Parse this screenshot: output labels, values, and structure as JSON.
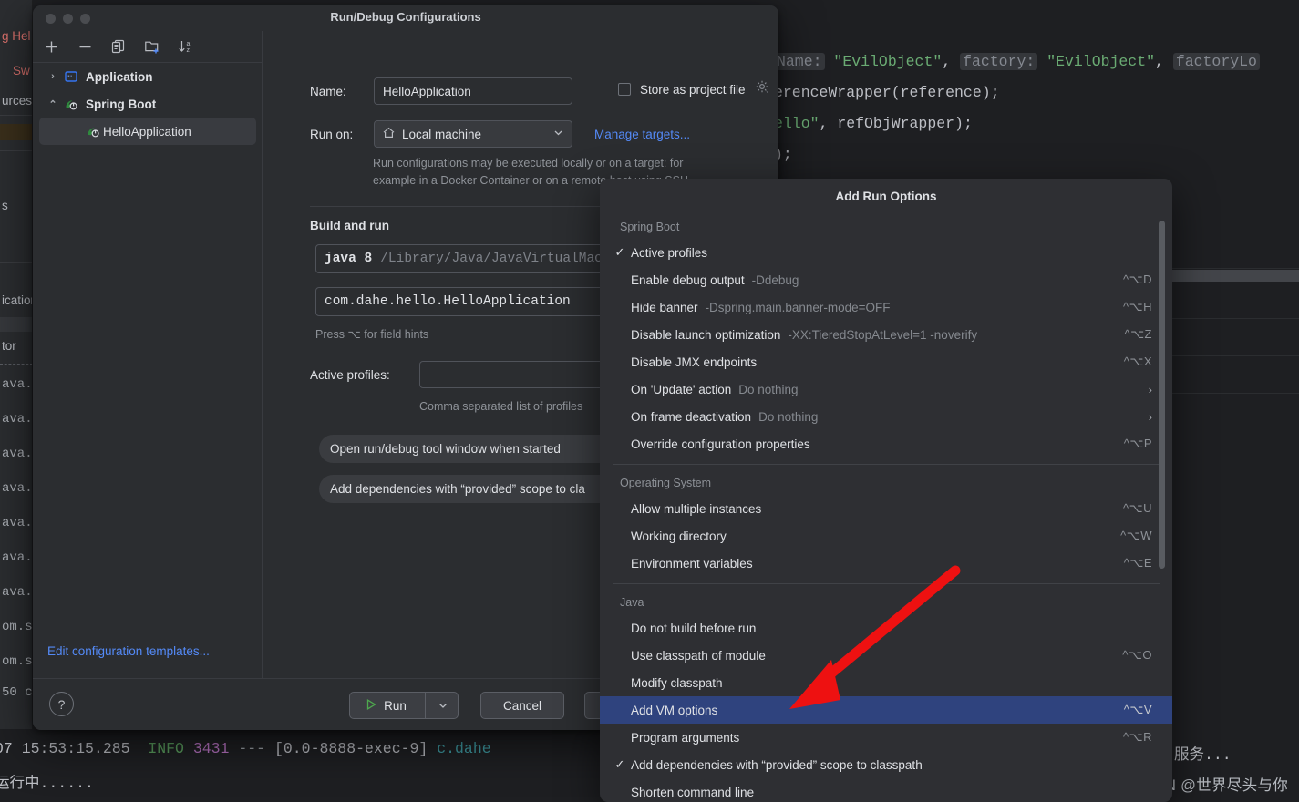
{
  "background": {
    "left_strip_lines": [
      "g Hel",
      "Sw",
      "urces",
      "s",
      "ication",
      "tor",
      "ava.",
      "ava.",
      "ava.",
      "ava.",
      "ava.",
      "ava.",
      "ava.",
      "om.s",
      "om.s",
      "50  c"
    ],
    "editor_code_lines": [
      "Name: \"EvilObject\",  factory: \"EvilObject\",  factoryLo",
      "erenceWrapper(reference);",
      "ello\", refObjWrapper);",
      ");"
    ],
    "console_left": "07 15:53:15.285  INFO 3431 --- [0.0-8888-exec-9] c.dahe",
    "console_left_2": "运行中......",
    "console_right": "服务...",
    "watermark": "CSDN @世界尽头与你"
  },
  "dialog": {
    "title": "Run/Debug Configurations",
    "toolbar_icons": [
      "add-icon",
      "remove-icon",
      "copy-icon",
      "new-folder-icon",
      "sort-alphabetically-icon"
    ],
    "tree": [
      {
        "label": "Application",
        "icon": "application-icon",
        "chevron": "›",
        "level": 0,
        "selected": false,
        "bold": true
      },
      {
        "label": "Spring Boot",
        "icon": "spring-boot-icon",
        "chevron": "⌄",
        "level": 0,
        "selected": false,
        "bold": true
      },
      {
        "label": "HelloApplication",
        "icon": "spring-boot-icon",
        "chevron": "",
        "level": 1,
        "selected": true,
        "bold": false
      }
    ],
    "edit_templates_link": "Edit configuration templates...",
    "form": {
      "name_label": "Name:",
      "name_value": "HelloApplication",
      "store_as_project_file_label": "Store as project file",
      "store_as_project_file_checked": false,
      "run_on_label": "Run on:",
      "run_on_value": "Local machine",
      "manage_targets_link": "Manage targets...",
      "run_on_hint_line1": "Run configurations may be executed locally or on a target: for",
      "run_on_hint_line2": "example in a Docker Container or on a remote host using SSH.",
      "build_and_run_title": "Build and run",
      "jdk_strong": "java 8",
      "jdk_path": "/Library/Java/JavaVirtualMachin",
      "main_class": "com.dahe.hello.HelloApplication",
      "field_hints": "Press ⌥ for field hints",
      "active_profiles_label": "Active profiles:",
      "active_profiles_value": "",
      "active_profiles_hint": "Comma separated list of profiles",
      "chip1": "Open run/debug tool window when started",
      "chip1_close": "×",
      "chip2": "Add dependencies with “provided” scope to cla"
    },
    "footer": {
      "help_label": "?",
      "run_label": "Run",
      "run_dropdown": "⌄",
      "cancel_label": "Cancel"
    }
  },
  "popup": {
    "title": "Add Run Options",
    "groups": [
      {
        "label": "Spring Boot",
        "items": [
          {
            "label": "Active profiles",
            "sub": "",
            "accel": "",
            "checked": true,
            "submenu": false,
            "selected": false
          },
          {
            "label": "Enable debug output",
            "sub": "-Ddebug",
            "accel": "^⌥D",
            "checked": false,
            "submenu": false,
            "selected": false
          },
          {
            "label": "Hide banner",
            "sub": "-Dspring.main.banner-mode=OFF",
            "accel": "^⌥H",
            "checked": false,
            "submenu": false,
            "selected": false
          },
          {
            "label": "Disable launch optimization",
            "sub": "-XX:TieredStopAtLevel=1 -noverify",
            "accel": "^⌥Z",
            "checked": false,
            "submenu": false,
            "selected": false
          },
          {
            "label": "Disable JMX endpoints",
            "sub": "",
            "accel": "^⌥X",
            "checked": false,
            "submenu": false,
            "selected": false
          },
          {
            "label": "On 'Update' action",
            "sub": "Do nothing",
            "accel": "",
            "checked": false,
            "submenu": true,
            "selected": false
          },
          {
            "label": "On frame deactivation",
            "sub": "Do nothing",
            "accel": "",
            "checked": false,
            "submenu": true,
            "selected": false
          },
          {
            "label": "Override configuration properties",
            "sub": "",
            "accel": "^⌥P",
            "checked": false,
            "submenu": false,
            "selected": false
          }
        ]
      },
      {
        "label": "Operating System",
        "items": [
          {
            "label": "Allow multiple instances",
            "sub": "",
            "accel": "^⌥U",
            "checked": false,
            "submenu": false,
            "selected": false
          },
          {
            "label": "Working directory",
            "sub": "",
            "accel": "^⌥W",
            "checked": false,
            "submenu": false,
            "selected": false
          },
          {
            "label": "Environment variables",
            "sub": "",
            "accel": "^⌥E",
            "checked": false,
            "submenu": false,
            "selected": false
          }
        ]
      },
      {
        "label": "Java",
        "items": [
          {
            "label": "Do not build before run",
            "sub": "",
            "accel": "",
            "checked": false,
            "submenu": false,
            "selected": false
          },
          {
            "label": "Use classpath of module",
            "sub": "",
            "accel": "^⌥O",
            "checked": false,
            "submenu": false,
            "selected": false
          },
          {
            "label": "Modify classpath",
            "sub": "",
            "accel": "",
            "checked": false,
            "submenu": false,
            "selected": false
          },
          {
            "label": "Add VM options",
            "sub": "",
            "accel": "^⌥V",
            "checked": false,
            "submenu": false,
            "selected": true
          },
          {
            "label": "Program arguments",
            "sub": "",
            "accel": "^⌥R",
            "checked": false,
            "submenu": false,
            "selected": false
          },
          {
            "label": "Add dependencies with “provided” scope to classpath",
            "sub": "",
            "accel": "",
            "checked": true,
            "submenu": false,
            "selected": false
          },
          {
            "label": "Shorten command line",
            "sub": "",
            "accel": "",
            "checked": false,
            "submenu": false,
            "selected": false
          }
        ]
      }
    ]
  },
  "colors": {
    "accent_blue": "#548af7",
    "selection_blue": "#2f437e",
    "dialog_bg": "#2b2d30",
    "popup_bg": "#2e2f33",
    "arrow_red": "#ee1111",
    "green": "#5a9e5e"
  }
}
